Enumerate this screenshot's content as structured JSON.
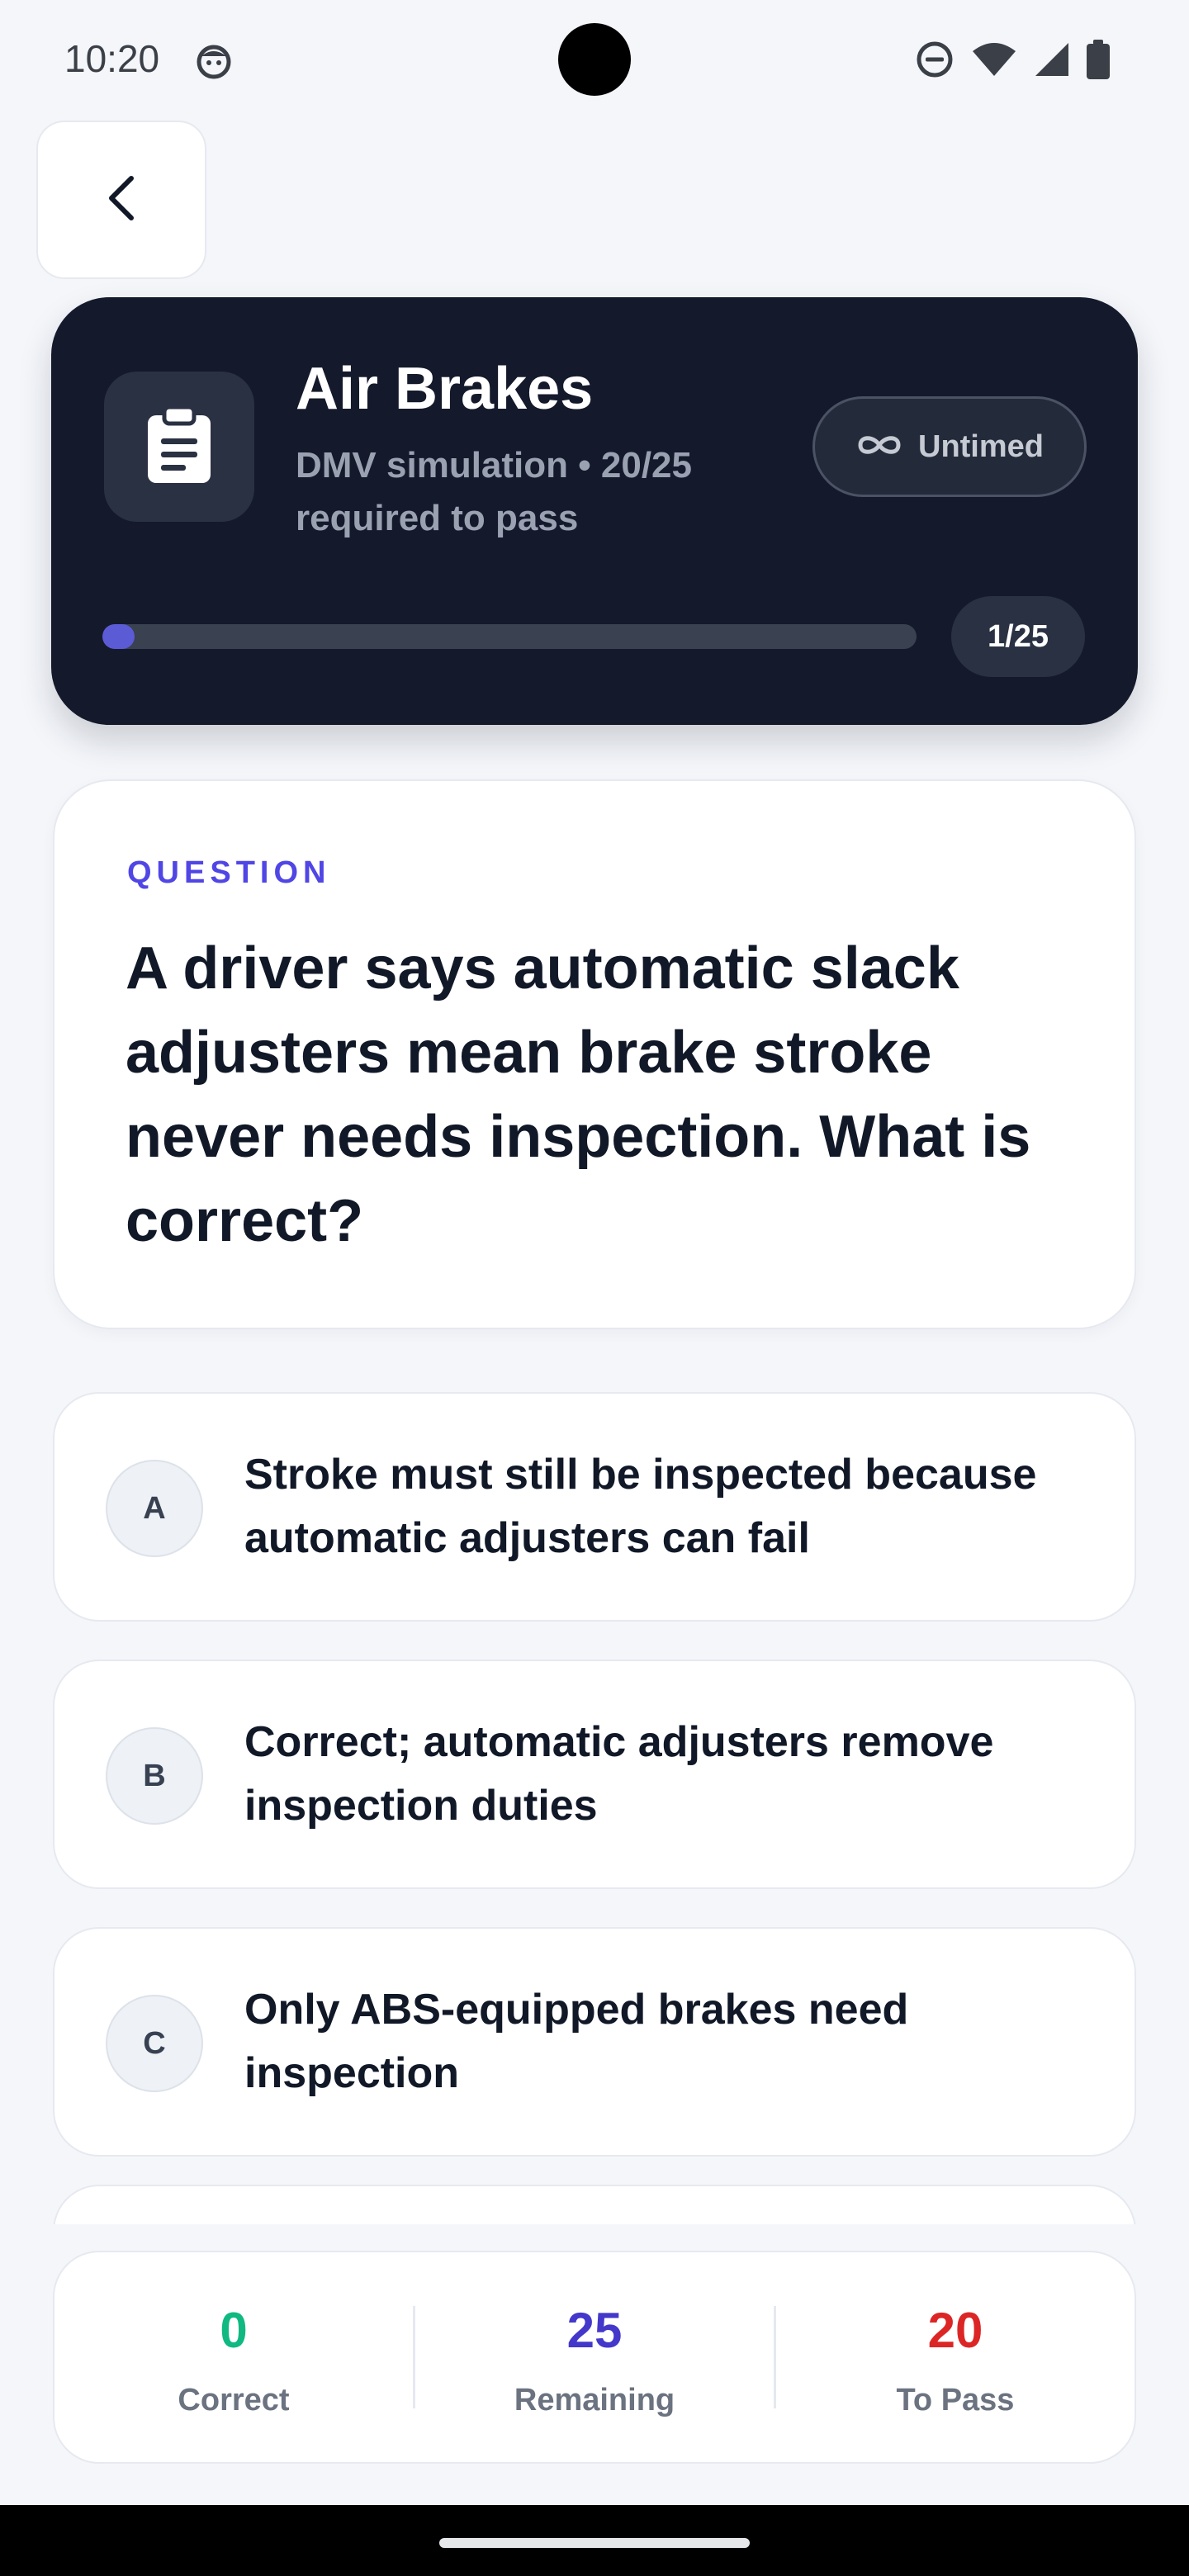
{
  "status_bar": {
    "time": "10:20",
    "icons": [
      "app-notification-icon",
      "do-not-disturb-icon",
      "wifi-icon",
      "cell-signal-icon",
      "battery-icon"
    ]
  },
  "back_button": {
    "icon": "chevron-left-icon"
  },
  "quiz": {
    "icon": "clipboard-icon",
    "title": "Air Brakes",
    "subtitle": "DMV simulation • 20/25 required to pass",
    "mode_icon": "infinity-icon",
    "mode_label": "Untimed",
    "progress_fraction": 0.04,
    "progress_label": "1/25"
  },
  "question": {
    "label": "QUESTION",
    "text": "A driver says automatic slack adjusters mean brake stroke never needs inspection. What is correct?"
  },
  "options": [
    {
      "letter": "A",
      "text": "Stroke must still be inspected because automatic adjusters can fail"
    },
    {
      "letter": "B",
      "text": "Correct; automatic adjusters remove inspection duties"
    },
    {
      "letter": "C",
      "text": "Only ABS-equipped brakes need inspection"
    }
  ],
  "stats": {
    "correct": {
      "value": "0",
      "label": "Correct",
      "color": "#10b981"
    },
    "remaining": {
      "value": "25",
      "label": "Remaining",
      "color": "#4338ca"
    },
    "to_pass": {
      "value": "20",
      "label": "To Pass",
      "color": "#dc2626"
    }
  },
  "colors": {
    "background": "#f4f6fa",
    "header_card": "#141a2b",
    "accent": "#5b5bd6",
    "question_label": "#5046e5"
  }
}
